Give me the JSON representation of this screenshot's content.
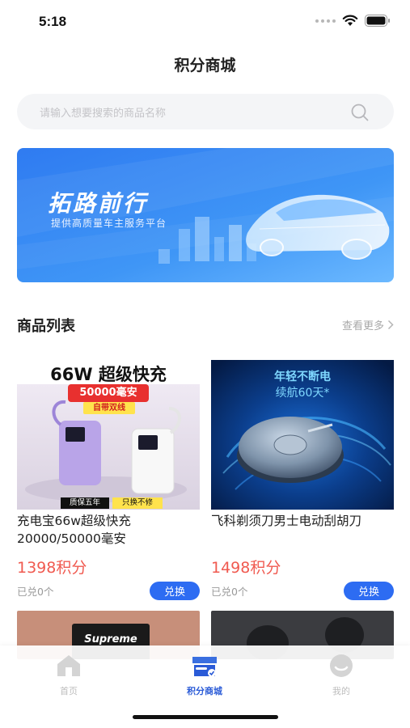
{
  "status_bar": {
    "time": "5:18"
  },
  "header": {
    "title": "积分商城"
  },
  "search": {
    "placeholder": "请输入想要搜索的商品名称"
  },
  "banner": {
    "title": "拓路前行",
    "subtitle": "提供高质量车主服务平台"
  },
  "section": {
    "title": "商品列表",
    "more_label": "查看更多"
  },
  "products": [
    {
      "name": "充电宝66w超级快充20000/50000毫安",
      "price": "1398积分",
      "sold": "已兑0个",
      "button": "兑换",
      "image_text": {
        "headline": "66W 超级快充",
        "capacity": "50000毫安",
        "cable": "自带双线",
        "warranty": "质保五年",
        "replace": "只换不修"
      }
    },
    {
      "name": "飞科剃须刀男士电动刮胡刀",
      "price": "1498积分",
      "sold": "已兑0个",
      "button": "兑换",
      "image_text": {
        "line1": "年轻不断电",
        "line2": "续航60天*"
      }
    }
  ],
  "partial_products": [
    {
      "image_text": "Supreme"
    },
    {
      "image_text": ""
    }
  ],
  "tabs": [
    {
      "label": "首页",
      "icon": "home-icon",
      "active": false
    },
    {
      "label": "积分商城",
      "icon": "store-icon",
      "active": true
    },
    {
      "label": "我的",
      "icon": "profile-icon",
      "active": false
    }
  ],
  "colors": {
    "accent": "#2d6cf2",
    "price": "#f05a50",
    "tab_active": "#2a5bd7"
  }
}
